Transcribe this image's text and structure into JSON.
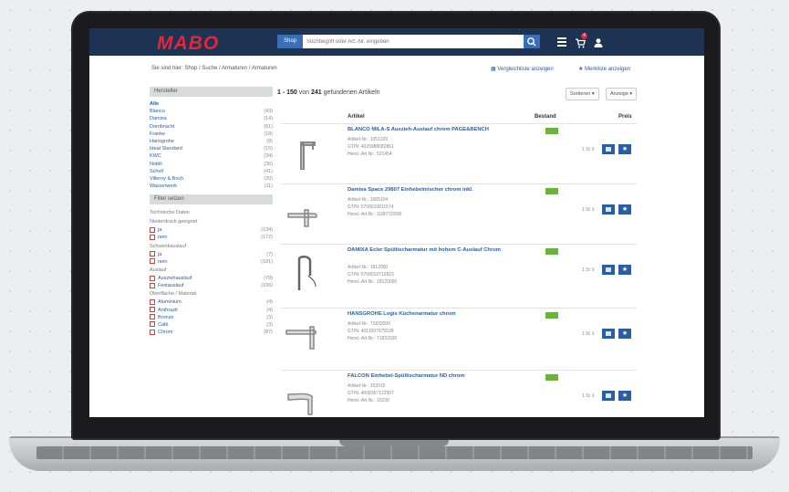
{
  "header": {
    "logo": "MABO",
    "search_scope": "Shop",
    "search_placeholder": "Suchbegriff oder Art.-Nr. eingeben",
    "cart_count": "4",
    "icons": [
      "search-icon",
      "menu-icon",
      "cart-icon",
      "user-icon"
    ]
  },
  "breadcrumb": "Sie sind hier: Shop / Suche / Armaturen / Armaturen",
  "top_links": {
    "compare": "Vergleichliste anzeigen",
    "wishlist": "Merkliste anzeigen"
  },
  "sidebar": {
    "manufacturer_title": "Hersteller",
    "manufacturers": [
      {
        "name": "Alle",
        "count": ""
      },
      {
        "name": "Blanco",
        "count": "(43)"
      },
      {
        "name": "Damixa",
        "count": "(14)"
      },
      {
        "name": "Dornbracht",
        "count": "(61)"
      },
      {
        "name": "Franke",
        "count": "(18)"
      },
      {
        "name": "Hansgrohe",
        "count": "(8)"
      },
      {
        "name": "Ideal Standard",
        "count": "(15)"
      },
      {
        "name": "KWC",
        "count": "(34)"
      },
      {
        "name": "Nobili",
        "count": "(36)"
      },
      {
        "name": "Schell",
        "count": "(41)"
      },
      {
        "name": "Villeroy & Boch",
        "count": "(20)"
      },
      {
        "name": "Wasserwerk",
        "count": "(11)"
      }
    ],
    "filter_title": "Filter setzen",
    "technical": "Technische Daten",
    "filter_groups": [
      {
        "label": "Niederdruck geeignet",
        "options": [
          {
            "name": "ja",
            "count": "(134)"
          },
          {
            "name": "nein",
            "count": "(172)"
          }
        ]
      },
      {
        "label": "Schwenkauslauf",
        "options": [
          {
            "name": "ja",
            "count": "(7)"
          },
          {
            "name": "nein",
            "count": "(181)"
          }
        ]
      },
      {
        "label": "Auslauf",
        "options": [
          {
            "name": "Ausziehauslauf",
            "count": "(79)"
          },
          {
            "name": "Festauslauf",
            "count": "(106)"
          }
        ]
      },
      {
        "label": "Oberfläche / Material",
        "options": [
          {
            "name": "Aluminium",
            "count": "(4)"
          },
          {
            "name": "Anthrazit",
            "count": "(4)"
          },
          {
            "name": "Bronze",
            "count": "(3)"
          },
          {
            "name": "Café",
            "count": "(3)"
          },
          {
            "name": "Chrom",
            "count": "(87)"
          }
        ]
      }
    ]
  },
  "results": {
    "range": "1 - 150",
    "of": "von",
    "total": "241",
    "found": "gefundenen Artikeln",
    "sort_label": "Sortieren",
    "view_label": "Anzeige",
    "col_article": "Artikel",
    "col_stock": "Bestand",
    "col_price": "Preis",
    "products": [
      {
        "name": "BLANCO MILA-S Auszieh-Auslauf chrom PAGE&BENCH",
        "art": "Artikel-Nr.: 1051020",
        "ean": "GTIN: 4025988082861",
        "herst": "Herst.-Art.Nr.: 521454",
        "qty": "1 St"
      },
      {
        "name": "Damixa Space 29807 Einhebelmischer chrom inkl.",
        "art": "Artikel-Nr.: 1065104",
        "ean": "GTIN: 5708019811574",
        "herst": "Herst.-Art.Nr.: 1180710990",
        "qty": "1 St"
      },
      {
        "name": "DAMIXA Ecler Spültischarmatur mit hohem C-Auslauf Chrom",
        "art": "Artikel-Nr.: 1812000",
        "ean": "GTIN: 5708019712815",
        "herst": "Herst.-Art.Nr.: 18120000",
        "qty": "1 St"
      },
      {
        "name": "HANSGROHE Logis Küchenarmatur chrom",
        "art": "Artikel-Nr.: 71832000",
        "ean": "GTIN: 4011097675528",
        "herst": "Herst.-Art.Nr.: 71832000",
        "qty": "1 St"
      },
      {
        "name": "FALCON Einhebel-Spültischarmatur ND chrom",
        "art": "Artikel-Nr.: 152015",
        "ean": "GTIN: 4008357122907",
        "herst": "Herst.-Art.Nr.: 15230",
        "qty": "1 St"
      }
    ]
  },
  "colors": {
    "header": "#1d3354",
    "accent": "#e2273a",
    "link": "#2b5ca6",
    "stock": "#6ab43c"
  }
}
